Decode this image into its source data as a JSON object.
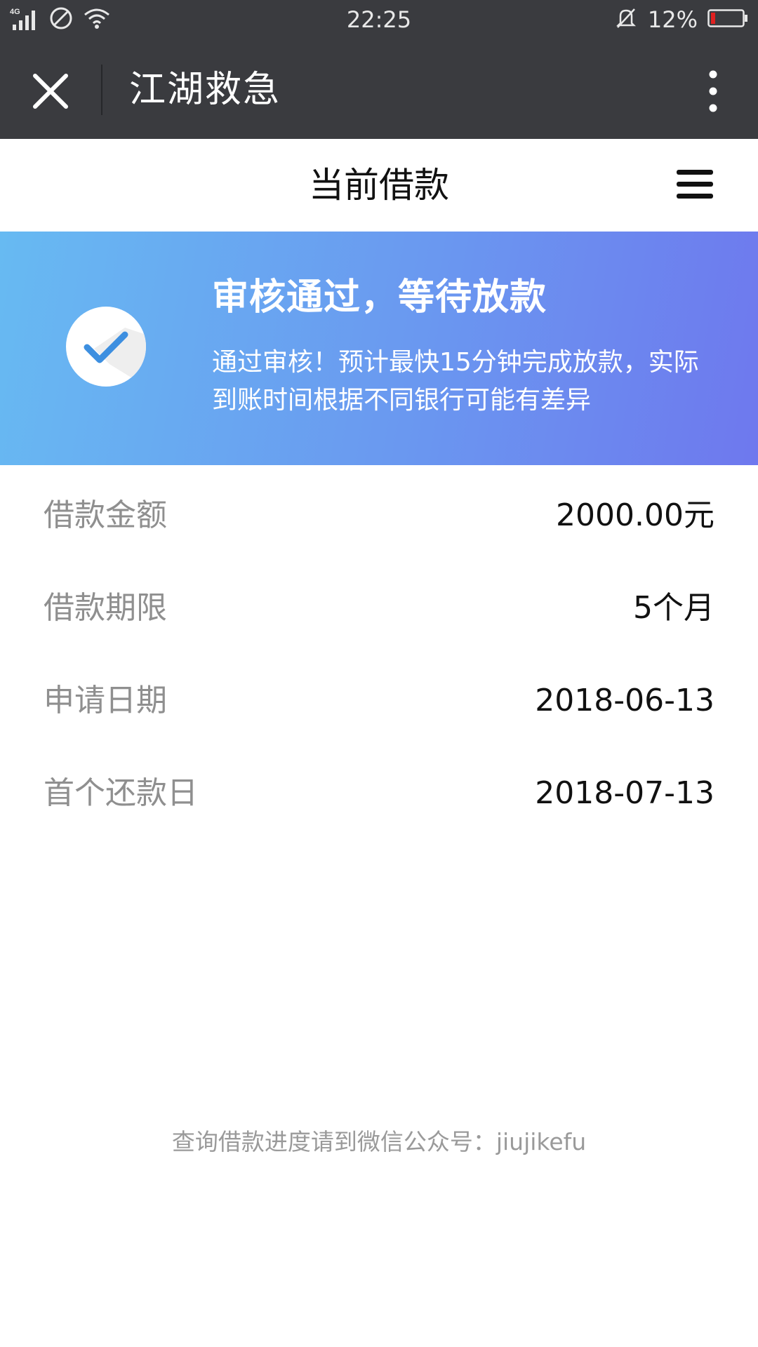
{
  "status_bar": {
    "network": "4G",
    "time": "22:25",
    "battery": "12%"
  },
  "title_bar": {
    "title": "江湖救急"
  },
  "page_header": {
    "title": "当前借款"
  },
  "banner": {
    "title": "审核通过，等待放款",
    "description": "通过审核！预计最快15分钟完成放款，实际到账时间根据不同银行可能有差异"
  },
  "details": [
    {
      "label": "借款金额",
      "value": "2000.00元"
    },
    {
      "label": "借款期限",
      "value": "5个月"
    },
    {
      "label": "申请日期",
      "value": "2018-06-13"
    },
    {
      "label": "首个还款日",
      "value": "2018-07-13"
    }
  ],
  "footer": {
    "note": "查询借款进度请到微信公众号：jiujikefu"
  },
  "colors": {
    "title_bar_bg": "#3a3b3f",
    "banner_start": "#67baf2",
    "banner_end": "#6e78ee",
    "check_color": "#3d8fe0",
    "battery_low": "#e02020"
  }
}
